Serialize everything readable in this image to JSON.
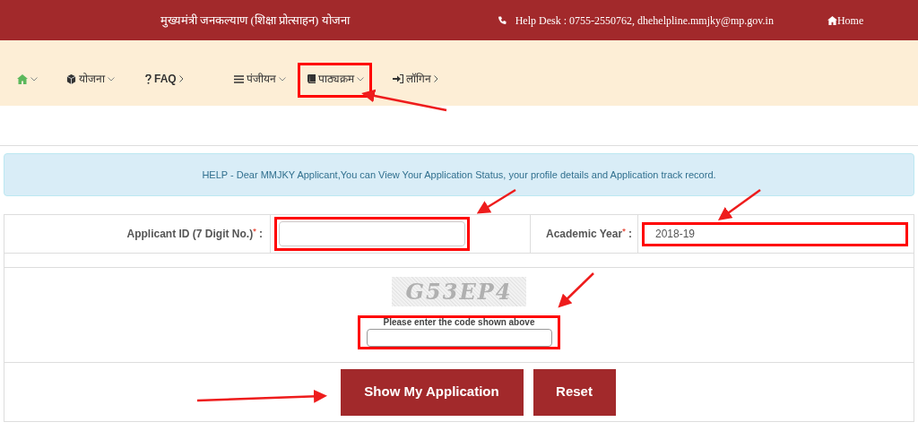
{
  "header": {
    "title": "मुख्यमंत्री जनकल्याण (शिक्षा प्रोत्साहन) योजना",
    "helpdesk": "Help Desk : 0755-2550762, dhehelpline.mmjky@mp.gov.in",
    "home_link": "Home"
  },
  "nav": [
    {
      "kind": "home",
      "opens_down": true,
      "highlighted": false
    },
    {
      "kind": "box",
      "label": "योजना",
      "opens_down": true,
      "highlighted": false
    },
    {
      "kind": "faq",
      "label": "FAQ",
      "opens_down": false,
      "highlighted": false
    },
    {
      "kind": "list",
      "label": "पंजीयन",
      "opens_down": true,
      "highlighted": false
    },
    {
      "kind": "book",
      "label": "पाठ्यक्रम",
      "opens_down": true,
      "highlighted": true
    },
    {
      "kind": "login",
      "label": "लॉगिन",
      "opens_down": false,
      "highlighted": false
    }
  ],
  "help": "HELP - Dear MMJKY Applicant,You can View Your Application Status, your profile details and Application track record.",
  "form": {
    "applicant_id": {
      "label": "Applicant ID (7 Digit No.)",
      "required": "*",
      "separator": ":",
      "highlighted": true
    },
    "academic_year": {
      "label": "Academic Year",
      "required": "*",
      "separator": ":",
      "value": "2018-19",
      "highlighted": true
    },
    "captcha": {
      "code": "G53EP4",
      "prompt": "Please enter the code shown above",
      "highlighted": true
    }
  },
  "buttons": [
    "Show My Application",
    "Reset"
  ]
}
